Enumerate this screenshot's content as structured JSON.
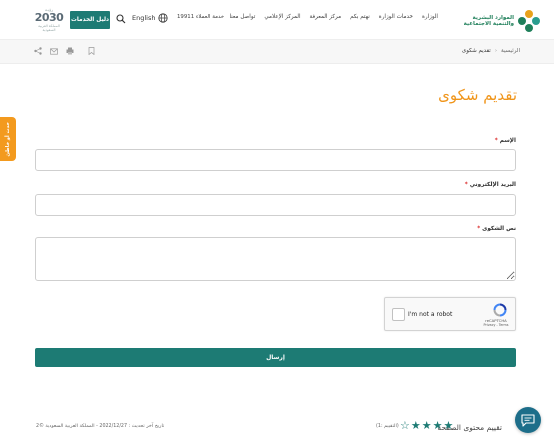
{
  "header": {
    "org_name_line1": "الموارد البشرية",
    "org_name_line2": "والتنمية الاجتماعية",
    "nav": [
      "الوزارة",
      "خدمات الوزارة",
      "نهتم بكم",
      "مركز المعرفة",
      "المركز الإعلامي",
      "تواصل معنا"
    ],
    "customer_service": "خدمة العملاء 19911",
    "language": "English",
    "services_guide": "دليل الخدمات",
    "vision_top": "رؤيـة",
    "vision_number": "2030",
    "vision_sub": "المملكة العربية السعودية"
  },
  "breadcrumb": {
    "home": "الرئيسية",
    "separator": "›",
    "current": "تقديم شكوى"
  },
  "side_tab": "حدث أو خاطئ",
  "page": {
    "title": "تقديم شكوى"
  },
  "form": {
    "name_label": "الإسم",
    "email_label": "البريد الإلكتروني",
    "complaint_label": "نص الشكوى",
    "required_mark": "*",
    "submit_label": "إرسال"
  },
  "captcha": {
    "label": "I'm not a robot",
    "brand": "reCAPTCHA",
    "links": "Privacy - Terms"
  },
  "footer": {
    "rate_title": "تقييم محتوى الصفحة",
    "rating": 4,
    "rating_max": 5,
    "rate_count": "(التقييم :1)",
    "last_update": "تاريخ آخر تحديث : 2022/12/27 - المملكة العربية السعودية ©2"
  },
  "colors": {
    "brand_teal": "#1d7b74",
    "accent_orange": "#f0951a",
    "side_tab_orange": "#f39a1e"
  }
}
